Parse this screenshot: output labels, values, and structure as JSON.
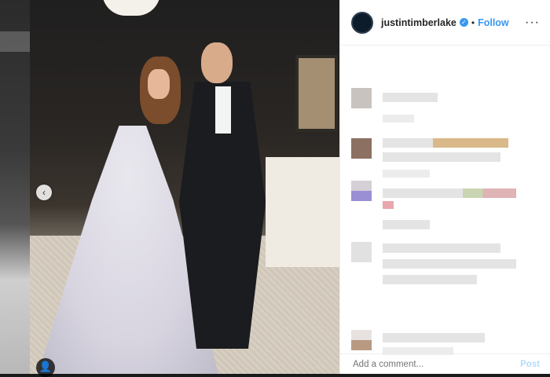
{
  "post": {
    "username": "justintimberlake",
    "verified_badge": "verified-icon",
    "separator": "•",
    "follow_label": "Follow",
    "more_label": "···"
  },
  "photo": {
    "prev_arrow": "‹",
    "tag_icon": "👤"
  },
  "comment_box": {
    "placeholder": "Add a comment...",
    "post_label": "Post"
  },
  "colors": {
    "accent": "#3897f0",
    "post_disabled": "#b2dffc"
  }
}
